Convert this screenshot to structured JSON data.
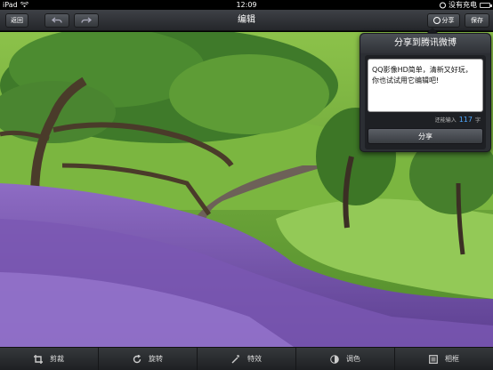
{
  "status_bar": {
    "device": "iPad",
    "time": "12:09",
    "charging_text": "没有充电"
  },
  "navbar": {
    "back_label": "返回",
    "title": "编辑",
    "share_label": "分享",
    "save_label": "保存"
  },
  "share_popover": {
    "title": "分享到腾讯微博",
    "message": "QQ影像HD简单，清新又好玩，你也试试用它编辑吧!",
    "remaining_label": "还能输入",
    "remaining_count": "117",
    "remaining_unit": "字",
    "submit_label": "分享"
  },
  "toolbar": {
    "items": [
      {
        "label": "剪裁",
        "icon": "crop-icon"
      },
      {
        "label": "旋转",
        "icon": "rotate-icon"
      },
      {
        "label": "特效",
        "icon": "effects-icon"
      },
      {
        "label": "调色",
        "icon": "color-adjust-icon"
      },
      {
        "label": "相框",
        "icon": "frame-icon"
      }
    ]
  },
  "colors": {
    "accent_count": "#4fa8ff",
    "bar_dark": "#24262a"
  }
}
